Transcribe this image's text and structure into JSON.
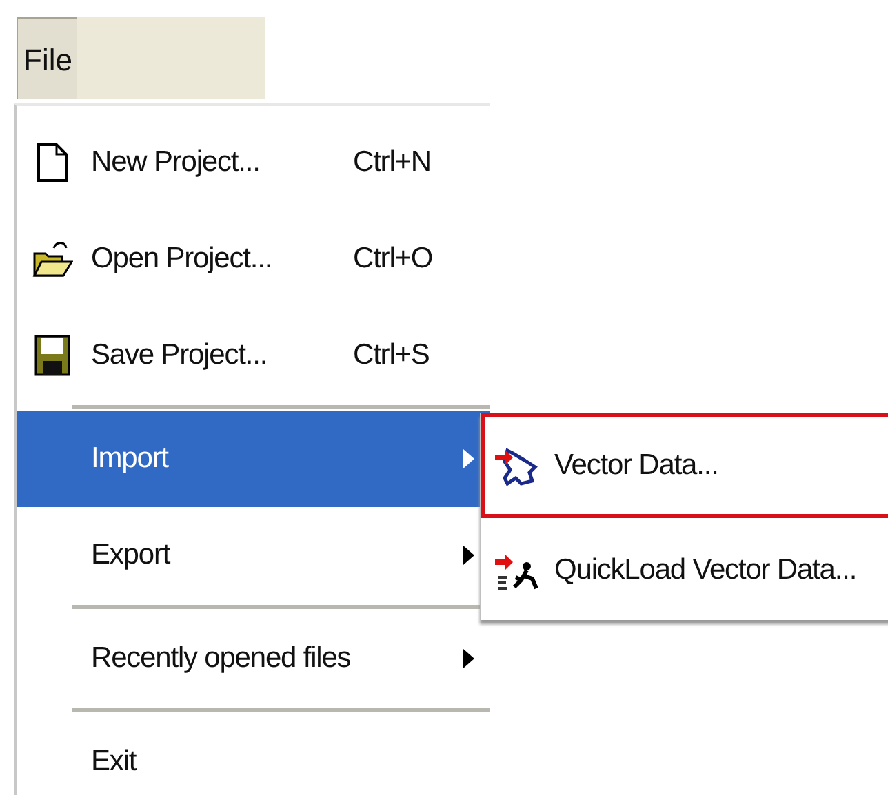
{
  "menubar": [
    {
      "label": "File",
      "selected": true
    }
  ],
  "menu": [
    {
      "kind": "item",
      "label": "New Project...",
      "shortcut": "Ctrl+N",
      "submenu": false,
      "selected": false
    },
    {
      "kind": "item",
      "label": "Open Project...",
      "shortcut": "Ctrl+O",
      "submenu": false,
      "selected": false
    },
    {
      "kind": "item",
      "label": "Save Project...",
      "shortcut": "Ctrl+S",
      "submenu": false,
      "selected": false
    },
    {
      "kind": "separator"
    },
    {
      "kind": "item",
      "label": "Import",
      "submenu": true,
      "selected": true
    },
    {
      "kind": "item",
      "label": "Export",
      "submenu": true,
      "selected": false
    },
    {
      "kind": "separator"
    },
    {
      "kind": "item",
      "label": "Recently opened files",
      "submenu": true,
      "selected": false
    },
    {
      "kind": "separator"
    },
    {
      "kind": "item",
      "label": "Exit",
      "submenu": false,
      "selected": false
    }
  ],
  "submenu": [
    {
      "label": "Vector Data...",
      "outlined": true
    },
    {
      "label": "QuickLoad Vector Data...",
      "outlined": false
    }
  ]
}
